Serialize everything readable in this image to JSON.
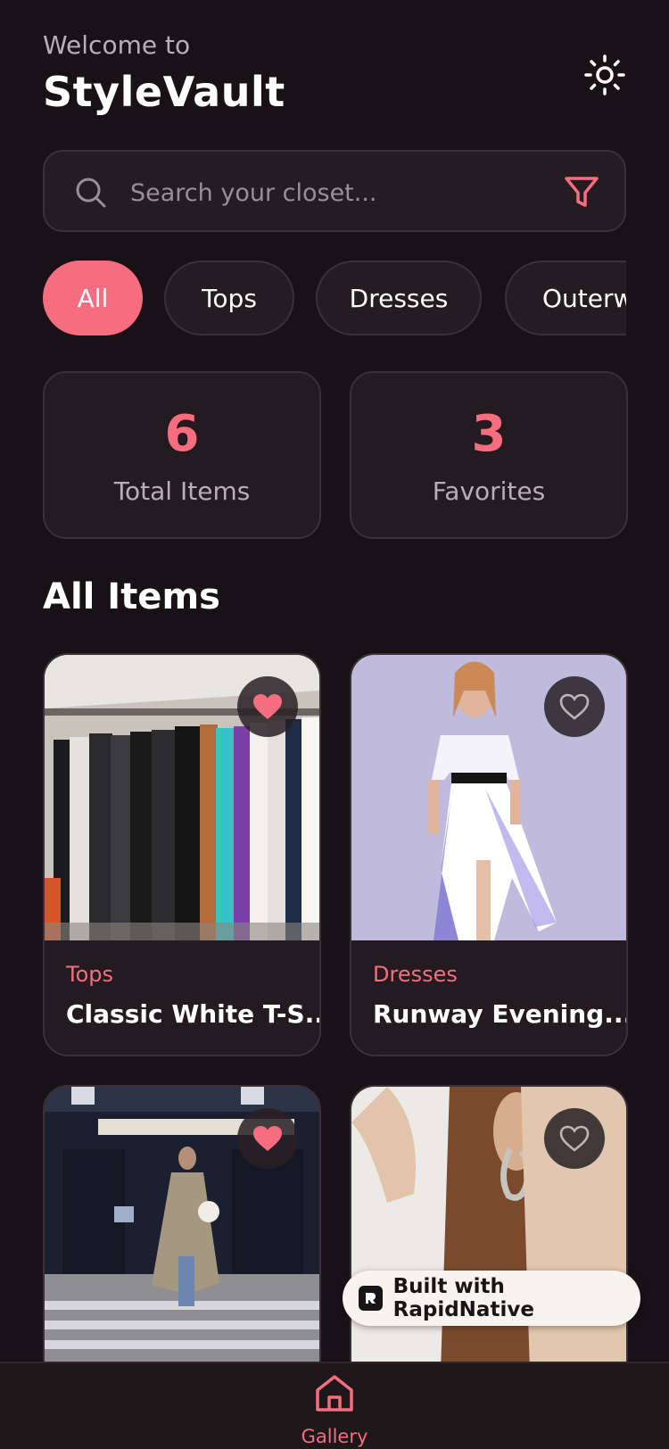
{
  "header": {
    "welcome": "Welcome to",
    "title": "StyleVault",
    "theme_icon": "sun-icon"
  },
  "search": {
    "placeholder": "Search your closet...",
    "value": "",
    "search_icon": "search-icon",
    "filter_icon": "filter-icon"
  },
  "categories": [
    {
      "label": "All",
      "active": true
    },
    {
      "label": "Tops",
      "active": false
    },
    {
      "label": "Dresses",
      "active": false
    },
    {
      "label": "Outerwear",
      "active": false
    }
  ],
  "stats": {
    "total_value": "6",
    "total_label": "Total Items",
    "favorites_value": "3",
    "favorites_label": "Favorites"
  },
  "section_title": "All Items",
  "items": [
    {
      "category": "Tops",
      "name": "Classic White T-S...",
      "favorite": true
    },
    {
      "category": "Dresses",
      "name": "Runway Evening...",
      "favorite": false
    },
    {
      "category": "",
      "name": "",
      "favorite": true
    },
    {
      "category": "",
      "name": "",
      "favorite": false
    }
  ],
  "badge": {
    "text": "Built with RapidNative"
  },
  "tabbar": {
    "gallery_label": "Gallery",
    "gallery_icon": "home-icon"
  },
  "colors": {
    "accent": "#f66d7f",
    "background": "#181216",
    "card": "#231b20"
  }
}
